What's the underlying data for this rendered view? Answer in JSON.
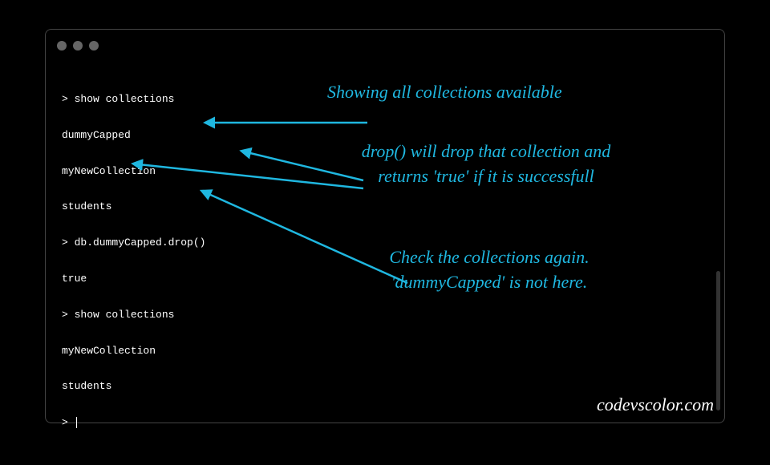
{
  "terminal": {
    "lines": [
      "> show collections",
      "dummyCapped",
      "myNewCollection",
      "students",
      "> db.dummyCapped.drop()",
      "true",
      "> show collections",
      "myNewCollection",
      "students",
      "> "
    ]
  },
  "annotations": {
    "a1": "Showing all collections available",
    "a2": "drop() will drop that collection and\nreturns 'true' if it is successfull",
    "a3": "Check the collections again.\n'dummyCapped' is not here."
  },
  "watermark": "codevscolor.com",
  "colors": {
    "annotation": "#1fb7e0",
    "text": "#ffffff",
    "background": "#000000"
  }
}
